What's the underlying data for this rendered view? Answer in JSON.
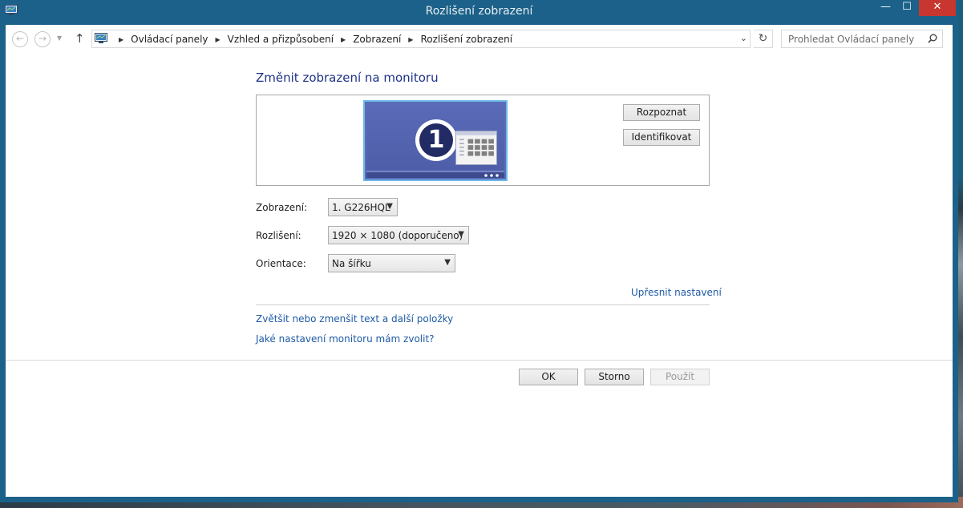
{
  "window": {
    "title": "Rozlišení zobrazení",
    "controls": {
      "minimize": "—",
      "maximize": "☐",
      "close": "✕"
    }
  },
  "nav": {
    "back": "←",
    "forward": "→",
    "recent": "▼",
    "up": "↑"
  },
  "address": {
    "crumbs": [
      "Ovládací panely",
      "Vzhled a přizpůsobení",
      "Zobrazení",
      "Rozlišení zobrazení"
    ],
    "dropdown": "⌄",
    "refresh": "↻"
  },
  "search": {
    "placeholder": "Prohledat Ovládací panely"
  },
  "main": {
    "title": "Změnit zobrazení na monitoru",
    "monitor_number": "1",
    "detect_button": "Rozpoznat",
    "identify_button": "Identifikovat",
    "fields": {
      "display": {
        "label": "Zobrazení:",
        "value": "1. G226HQL"
      },
      "resolution": {
        "label": "Rozlišení:",
        "value": "1920 × 1080 (doporučeno)"
      },
      "orientation": {
        "label": "Orientace:",
        "value": "Na šířku"
      }
    },
    "advanced_link": "Upřesnit nastavení",
    "text_size_link": "Zvětšit nebo zmenšit text a další položky",
    "which_settings_link": "Jaké nastavení monitoru mám zvolit?"
  },
  "footer": {
    "ok": "OK",
    "cancel": "Storno",
    "apply": "Použít"
  },
  "colors": {
    "window_frame": "#1b6189",
    "close_button": "#c7372f",
    "link": "#1e5aa6",
    "title": "#1e3287"
  }
}
